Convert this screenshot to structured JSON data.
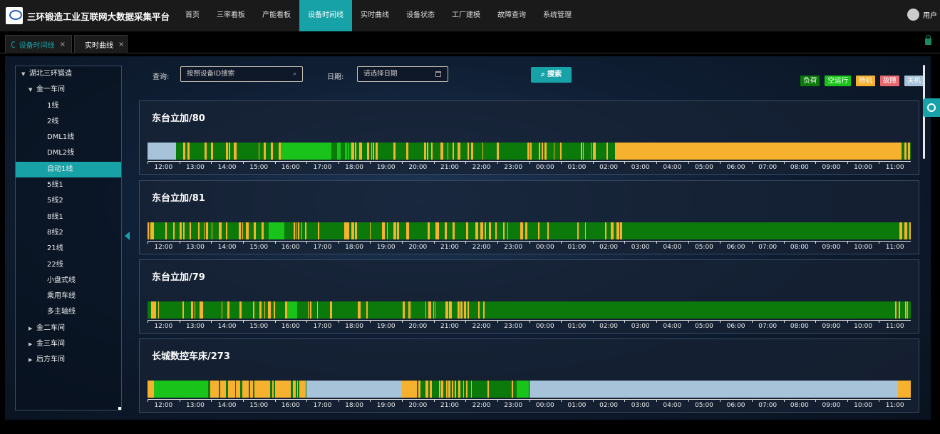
{
  "app": {
    "title": "三环锻造工业互联网大数据采集平台",
    "user": "用户"
  },
  "nav": [
    "首页",
    "三率看板",
    "产能看板",
    "设备时间线",
    "实时曲线",
    "设备状态",
    "工厂建模",
    "故障查询",
    "系统管理"
  ],
  "nav_active": 3,
  "tabs": [
    {
      "label": "设备时间线",
      "active": true
    },
    {
      "label": "实时曲线",
      "active": false
    }
  ],
  "tree": [
    {
      "label": "湖北三环锻造",
      "level": 0,
      "arrow": "▼"
    },
    {
      "label": "金一车间",
      "level": 1,
      "arrow": "▼"
    },
    {
      "label": "1线",
      "level": 2
    },
    {
      "label": "2线",
      "level": 2
    },
    {
      "label": "DML1线",
      "level": 2
    },
    {
      "label": "DML2线",
      "level": 2
    },
    {
      "label": "自动1线",
      "level": 2,
      "selected": true
    },
    {
      "label": "5线1",
      "level": 2
    },
    {
      "label": "5线2",
      "level": 2
    },
    {
      "label": "8线1",
      "level": 2
    },
    {
      "label": "8线2",
      "level": 2
    },
    {
      "label": "21线",
      "level": 2
    },
    {
      "label": "22线",
      "level": 2
    },
    {
      "label": "小盘式线",
      "level": 2
    },
    {
      "label": "乘用车线",
      "level": 2
    },
    {
      "label": "多主轴线",
      "level": 2
    },
    {
      "label": "金二车间",
      "level": 1,
      "arrow": "▶"
    },
    {
      "label": "金三车间",
      "level": 1,
      "arrow": "▶"
    },
    {
      "label": "后方车间",
      "level": 1,
      "arrow": "▶"
    }
  ],
  "query": {
    "label": "查询:",
    "search_placeholder": "按照设备ID搜索",
    "date_label": "日期:",
    "date_placeholder": "请选择日期",
    "search_button": "搜索"
  },
  "legend": [
    {
      "label": "负荷",
      "color": "#0b7a0b"
    },
    {
      "label": "空运行",
      "color": "#19c319"
    },
    {
      "label": "待机",
      "color": "#f6b12e"
    },
    {
      "label": "故障",
      "color": "#e8686f"
    },
    {
      "label": "关机",
      "color": "#a7c3d9"
    }
  ],
  "hours": [
    "12:00",
    "13:00",
    "14:00",
    "15:00",
    "16:00",
    "17:00",
    "18:00",
    "19:00",
    "20:00",
    "21:00",
    "22:00",
    "23:00",
    "00:00",
    "01:00",
    "02:00",
    "03:00",
    "04:00",
    "05:00",
    "06:00",
    "07:00",
    "08:00",
    "09:00",
    "10:00",
    "11:00"
  ],
  "timelines": [
    {
      "title": "东台立加/80",
      "base": "#0b7a0b",
      "segments": [
        {
          "state": "关机",
          "start": 12.0,
          "end": 12.9
        },
        {
          "state": "负荷",
          "start": 12.9,
          "end": 16.2,
          "stripes": "待机",
          "density": 0.35
        },
        {
          "state": "空运行",
          "start": 16.2,
          "end": 17.7
        },
        {
          "state": "负荷",
          "start": 17.7,
          "end": 18.4,
          "stripes": "空运行",
          "density": 0.3
        },
        {
          "state": "负荷",
          "start": 18.4,
          "end": 20.4,
          "stripes": "待机",
          "density": 0.5
        },
        {
          "state": "负荷",
          "start": 20.4,
          "end": 26.7,
          "stripes": "待机",
          "density": 0.35
        },
        {
          "state": "待机",
          "start": 26.7,
          "end": 35.7
        },
        {
          "state": "负荷",
          "start": 35.7,
          "end": 36.0,
          "stripes": "待机",
          "density": 0.6
        }
      ]
    },
    {
      "title": "东台立加/81",
      "base": "#0b7a0b",
      "segments": [
        {
          "state": "负荷",
          "start": 12.0,
          "end": 15.8,
          "stripes": "待机",
          "density": 0.45
        },
        {
          "state": "空运行",
          "start": 15.8,
          "end": 16.3
        },
        {
          "state": "负荷",
          "start": 16.3,
          "end": 18.6,
          "stripes": "待机",
          "density": 0.35
        },
        {
          "state": "负荷",
          "start": 18.6,
          "end": 27.0,
          "stripes": "待机",
          "density": 0.3
        },
        {
          "state": "负荷",
          "start": 27.0,
          "end": 35.6
        },
        {
          "state": "负荷",
          "start": 35.6,
          "end": 36.0,
          "stripes": "待机",
          "density": 0.6
        }
      ]
    },
    {
      "title": "东台立加/79",
      "base": "#0b7a0b",
      "segments": [
        {
          "state": "负荷",
          "start": 12.0,
          "end": 16.4,
          "stripes": "待机",
          "density": 0.35
        },
        {
          "state": "空运行",
          "start": 16.4,
          "end": 16.7
        },
        {
          "state": "负荷",
          "start": 16.7,
          "end": 19.2,
          "stripes": "待机",
          "density": 0.25
        },
        {
          "state": "负荷",
          "start": 19.2,
          "end": 23.6,
          "stripes": "待机",
          "density": 0.3
        },
        {
          "state": "负荷",
          "start": 23.6,
          "end": 35.5
        },
        {
          "state": "负荷",
          "start": 35.5,
          "end": 36.0,
          "stripes": "待机",
          "density": 0.5
        }
      ]
    },
    {
      "title": "长城数控车床/273",
      "base": "#0b7a0b",
      "segments": [
        {
          "state": "待机",
          "start": 12.0,
          "end": 12.2
        },
        {
          "state": "空运行",
          "start": 12.2,
          "end": 13.9
        },
        {
          "state": "待机",
          "start": 13.9,
          "end": 17.0,
          "stripes": "负荷",
          "density": 0.35
        },
        {
          "state": "关机",
          "start": 17.0,
          "end": 20.0
        },
        {
          "state": "待机",
          "start": 20.0,
          "end": 20.4
        },
        {
          "state": "负荷",
          "start": 20.4,
          "end": 23.6,
          "stripes": "待机",
          "density": 0.5
        },
        {
          "state": "空运行",
          "start": 23.6,
          "end": 24.0
        },
        {
          "state": "关机",
          "start": 24.0,
          "end": 35.6
        },
        {
          "state": "待机",
          "start": 35.6,
          "end": 36.0
        }
      ]
    }
  ]
}
